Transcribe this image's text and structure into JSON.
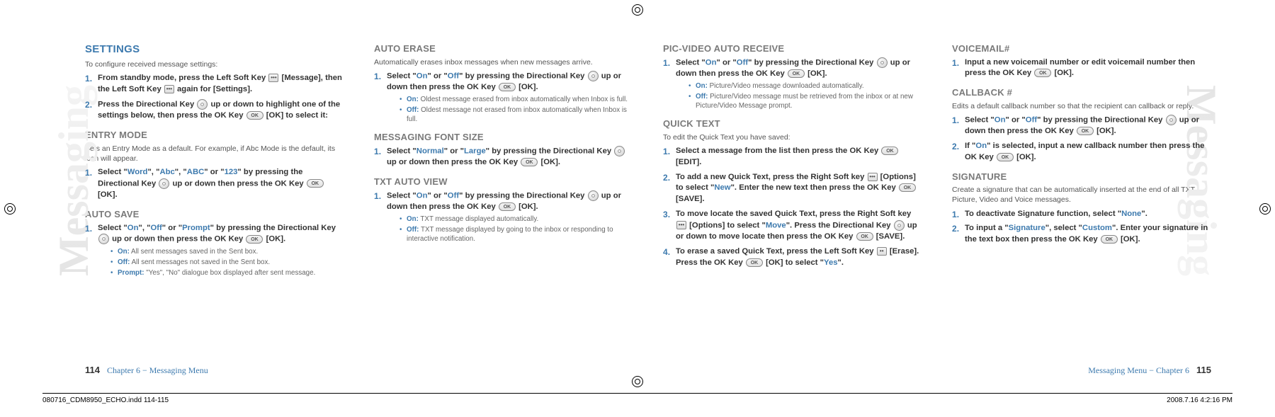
{
  "sideLabel": "Messaging",
  "col1": {
    "title": "SETTINGS",
    "intro": "To configure received message settings:",
    "step1_a": "From standby mode, press the Left Soft Key ",
    "step1_b": " [Message], then the Left Soft Key ",
    "step1_c": " again for [Settings].",
    "step2_a": "Press the Directional Key ",
    "step2_b": " up or down to highlight one of the settings below, then press the OK Key ",
    "step2_c": " [OK] to select it:",
    "entryTitle": "ENTRY MODE",
    "entryIntro": "Sets an Entry Mode as a default. For example, if Abc Mode is the default, its icon will appear.",
    "entry1_a": "Select \"",
    "word": "Word",
    "entry1_b": "\", \"",
    "abc1": "Abc",
    "entry1_c": "\", \"",
    "abc2": "ABC",
    "entry1_d": "\" or \"",
    "n123": "123",
    "entry1_e": "\" by pressing the Directional Key ",
    "entry1_f": " up or down then press the OK Key ",
    "entry1_g": " [OK].",
    "autosaveTitle": "AUTO SAVE",
    "as1_a": "Select \"",
    "on": "On",
    "as1_b": "\", \"",
    "off": "Off",
    "as1_c": "\" or \"",
    "prompt": "Prompt",
    "as1_d": "\" by pressing the Directional Key ",
    "as1_e": " up or down then press the OK Key ",
    "as1_f": " [OK].",
    "as_b1_l": "On:",
    "as_b1": " All sent messages saved in the Sent box.",
    "as_b2_l": "Off:",
    "as_b2": " All sent messages not saved in the Sent box.",
    "as_b3_l": "Prompt:",
    "as_b3": " \"Yes\", \"No\" dialogue box displayed after sent message."
  },
  "col2": {
    "aeTitle": "AUTO ERASE",
    "aeIntro": "Automatically erases inbox messages when new messages arrive.",
    "ae1_a": "Select \"",
    "ae1_b": "\" or \"",
    "ae1_c": "\" by pressing the Directional Key ",
    "ae1_d": " up or down then press the OK Key ",
    "ae1_e": " [OK].",
    "ae_b1_l": "On:",
    "ae_b1": " Oldest message erased from inbox automatically when Inbox is full.",
    "ae_b2_l": "Off:",
    "ae_b2": " Oldest message not erased from inbox automatically when Inbox is full.",
    "mfTitle": "MESSAGING FONT SIZE",
    "mf1_a": "Select \"",
    "normal": "Normal",
    "mf1_b": "\" or \"",
    "large": "Large",
    "mf1_c": "\" by pressing the Directional Key ",
    "mf1_d": " up or down then press the OK Key ",
    "mf1_e": " [OK].",
    "tavTitle": "TXT AUTO VIEW",
    "tav1_a": "Select \"",
    "tav1_b": "\" or \"",
    "tav1_c": "\" by pressing the Directional Key ",
    "tav1_d": " up or down then press the OK Key ",
    "tav1_e": " [OK].",
    "tav_b1_l": "On:",
    "tav_b1": " TXT message displayed automatically.",
    "tav_b2_l": "Off:",
    "tav_b2": " TXT message displayed by going to the inbox or responding to interactive notification."
  },
  "col3": {
    "pvTitle": "PIC-VIDEO AUTO RECEIVE",
    "pv1_a": "Select \"",
    "pv1_b": "\" or \"",
    "pv1_c": "\" by pressing the Directional Key ",
    "pv1_d": " up or down then press the OK Key ",
    "pv1_e": " [OK].",
    "pv_b1_l": "On:",
    "pv_b1": " Picture/Video message downloaded automatically.",
    "pv_b2_l": "Off:",
    "pv_b2": " Picture/Video message must be retrieved from the inbox or at new Picture/Video Message prompt.",
    "qtTitle": "QUICK TEXT",
    "qtIntro": "To edit the Quick Text you have saved:",
    "qt1_a": "Select a message from the list then press the OK Key ",
    "qt1_b": " [EDIT].",
    "qt2_a": "To add a new Quick Text, press the Right Soft key ",
    "qt2_b": " [Options] to select \"",
    "new": "New",
    "qt2_c": "\". Enter the new text then press the OK Key ",
    "qt2_d": " [SAVE].",
    "qt3_a": "To move locate the saved Quick Text, press the Right Soft key ",
    "qt3_b": " [Options] to select \"",
    "move": "Move",
    "qt3_c": "\". Press the Directional Key ",
    "qt3_d": " up or down to move locate then press the OK Key ",
    "qt3_e": " [SAVE].",
    "qt4_a": "To erase a saved Quick Text, press the Left Soft Key ",
    "qt4_b": " [Erase]. Press the OK Key ",
    "qt4_c": " [OK] to select \"",
    "yes": "Yes",
    "qt4_d": "\"."
  },
  "col4": {
    "vmTitle": "VOICEMAIL#",
    "vm1_a": "Input a new voicemail number or edit voicemail number then press the OK Key ",
    "vm1_b": " [OK].",
    "cbTitle": "CALLBACK #",
    "cbIntro": "Edits a default callback number so that the recipient can callback or reply.",
    "cb1_a": "Select \"",
    "cb1_b": "\" or \"",
    "cb1_c": "\" by pressing the Directional Key ",
    "cb1_d": " up or down then press the OK Key ",
    "cb1_e": " [OK].",
    "cb2_a": "If \"",
    "cb2_b": "\" is selected, input a new callback number then press the OK Key ",
    "cb2_c": " [OK].",
    "sigTitle": "SIGNATURE",
    "sigIntro": "Create a signature that can be automatically inserted at the end of all TXT, Picture, Video and Voice messages.",
    "sig1_a": "To deactivate Signature function, select \"",
    "none": "None",
    "sig1_b": "\".",
    "sig2_a": "To input a \"",
    "signature": "Signature",
    "sig2_b": "\", select \"",
    "custom": "Custom",
    "sig2_c": "\". Enter your signature in the text box then press the OK Key ",
    "sig2_d": " [OK]."
  },
  "common": {
    "on": "On",
    "off": "Off",
    "ok": "OK"
  },
  "footer": {
    "leftNum": "114",
    "leftChap": "Chapter 6 − Messaging Menu",
    "rightChap": "Messaging Menu − Chapter 6",
    "rightNum": "115"
  },
  "meta": {
    "file": "080716_CDM8950_ECHO.indd   114-115",
    "stamp": "2008.7.16   4:2:16 PM"
  }
}
